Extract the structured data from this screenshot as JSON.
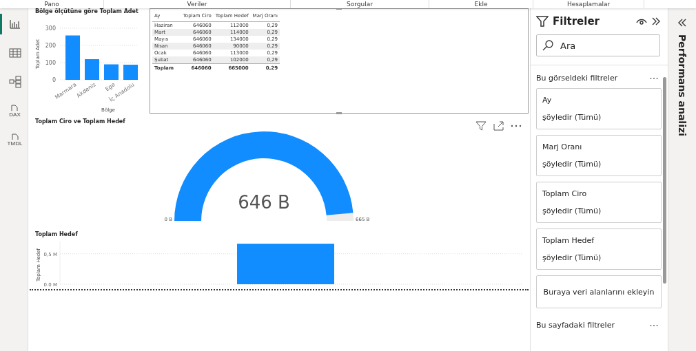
{
  "ribbon_tabs": [
    {
      "label": "Pano"
    },
    {
      "label": "Veriler"
    },
    {
      "label": "Sorgular"
    },
    {
      "label": "Ekle"
    },
    {
      "label": "Hesaplamalar"
    }
  ],
  "nav": [
    {
      "kind": "report",
      "selected": true
    },
    {
      "kind": "table",
      "selected": false
    },
    {
      "kind": "model",
      "selected": false
    },
    {
      "kind": "dax",
      "label": "DAX",
      "selected": false
    },
    {
      "kind": "tmdl",
      "label": "TMDL",
      "selected": false
    }
  ],
  "bar_chart": {
    "title": "Bölge ölçütüne göre Toplam Adet",
    "chart_data": {
      "type": "bar",
      "xlabel": "Bölge",
      "ylabel": "Toplam Adet",
      "categories": [
        "Marmara",
        "Akdeniz",
        "Ege",
        "İç Anadolu"
      ],
      "values": [
        258,
        120,
        90,
        88
      ],
      "ylim": [
        0,
        300
      ],
      "yticks": [
        0,
        100,
        200,
        300
      ]
    }
  },
  "table": {
    "columns": [
      "Ay",
      "Toplam Ciro",
      "Toplam Hedef",
      "Marj Oranı"
    ],
    "rows": [
      [
        "Haziran",
        "646060",
        "112000",
        "0,29"
      ],
      [
        "Mart",
        "646060",
        "114000",
        "0,29"
      ],
      [
        "Mayıs",
        "646060",
        "134000",
        "0,29"
      ],
      [
        "Nisan",
        "646060",
        "90000",
        "0,29"
      ],
      [
        "Ocak",
        "646060",
        "113000",
        "0,29"
      ],
      [
        "Şubat",
        "646060",
        "102000",
        "0,29"
      ]
    ],
    "total": [
      "Toplam",
      "646060",
      "665000",
      "0,29"
    ]
  },
  "gauge": {
    "title": "Toplam Ciro ve Toplam Hedef",
    "value": "646 B",
    "min": "0 B",
    "max": "665 B",
    "level": 0.971
  },
  "target_chart": {
    "title": "Toplam Hedef",
    "chart_data": {
      "type": "bar",
      "ylabel": "Toplam Hedef",
      "values": [
        665000
      ],
      "ylim": [
        0,
        700000
      ],
      "yticks": [
        {
          "value": 0,
          "label": "0,0 M"
        },
        {
          "value": 500000,
          "label": "0,5 M"
        }
      ]
    }
  },
  "filters": {
    "title": "Filtreler",
    "search": {
      "placeholder": "Ara"
    },
    "visual_section": "Bu görseldeki filtreler",
    "cards": [
      {
        "field": "Ay",
        "condition": "şöyledir (Tümü)"
      },
      {
        "field": "Marj Oranı",
        "condition": "şöyledir (Tümü)"
      },
      {
        "field": "Toplam Ciro",
        "condition": "şöyledir (Tümü)"
      },
      {
        "field": "Toplam Hedef",
        "condition": "şöyledir (Tümü)"
      }
    ],
    "dropzone": "Buraya veri alanlarını ekleyin",
    "page_section": "Bu sayfadaki filtreler"
  },
  "side_pane": {
    "title": "Performans analizi"
  }
}
